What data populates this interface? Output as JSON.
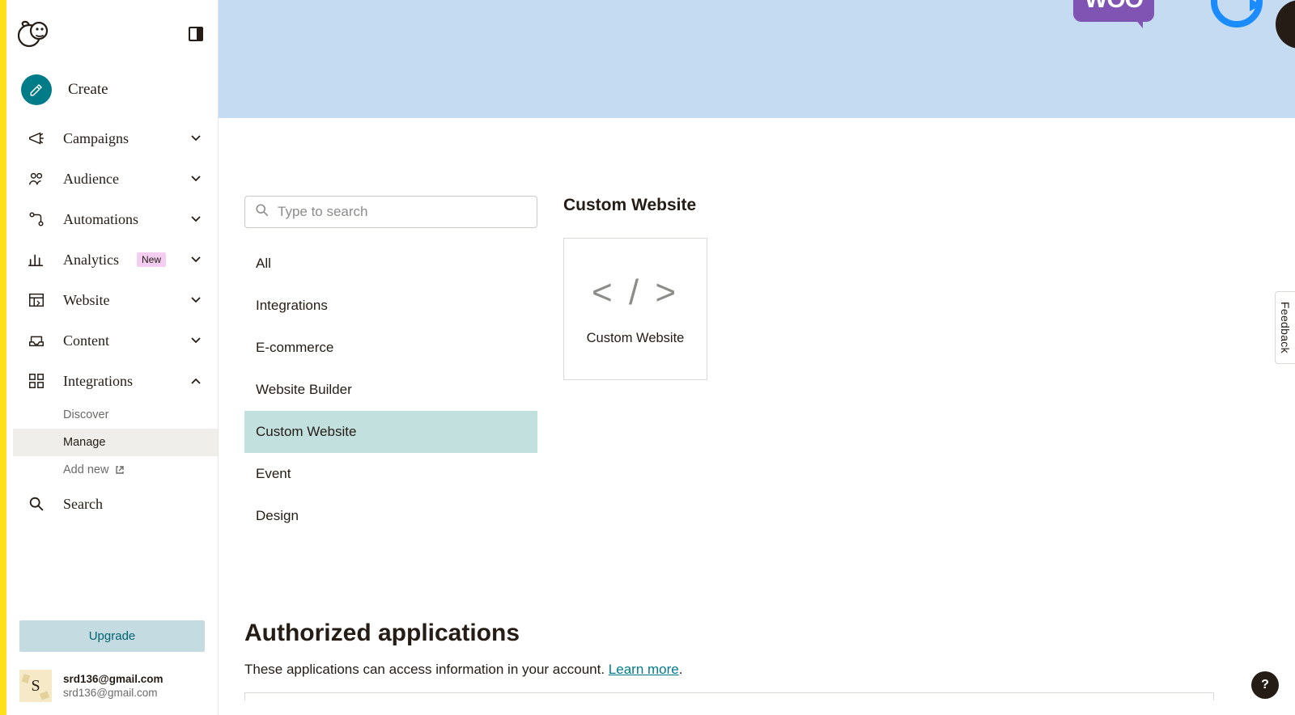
{
  "sidebar": {
    "create_label": "Create",
    "items": [
      {
        "label": "Campaigns",
        "icon": "megaphone",
        "expandable": true
      },
      {
        "label": "Audience",
        "icon": "people",
        "expandable": true
      },
      {
        "label": "Automations",
        "icon": "path",
        "expandable": true
      },
      {
        "label": "Analytics",
        "icon": "bars",
        "expandable": true,
        "badge": "New"
      },
      {
        "label": "Website",
        "icon": "layout",
        "expandable": true
      },
      {
        "label": "Content",
        "icon": "tray",
        "expandable": true
      },
      {
        "label": "Integrations",
        "icon": "grid",
        "expandable": true,
        "expanded": true
      }
    ],
    "integrations_sub": [
      {
        "label": "Discover"
      },
      {
        "label": "Manage",
        "active": true
      },
      {
        "label": "Add new",
        "external": true
      }
    ],
    "search_label": "Search",
    "upgrade_label": "Upgrade",
    "account": {
      "initial": "S",
      "line1": "srd136@gmail.com",
      "line2": "srd136@gmail.com"
    }
  },
  "banner": {
    "woo_text": "WOO"
  },
  "search": {
    "placeholder": "Type to search"
  },
  "categories": [
    "All",
    "Integrations",
    "E-commerce",
    "Website Builder",
    "Custom Website",
    "Event",
    "Design"
  ],
  "active_category": "Custom Website",
  "results": {
    "title": "Custom Website",
    "card_glyph": "< / >",
    "card_label": "Custom Website"
  },
  "auth": {
    "title": "Authorized applications",
    "desc_before": "These applications can access information in your account. ",
    "learn_more": "Learn more",
    "desc_after": "."
  },
  "feedback_label": "Feedback",
  "help_glyph": "?"
}
